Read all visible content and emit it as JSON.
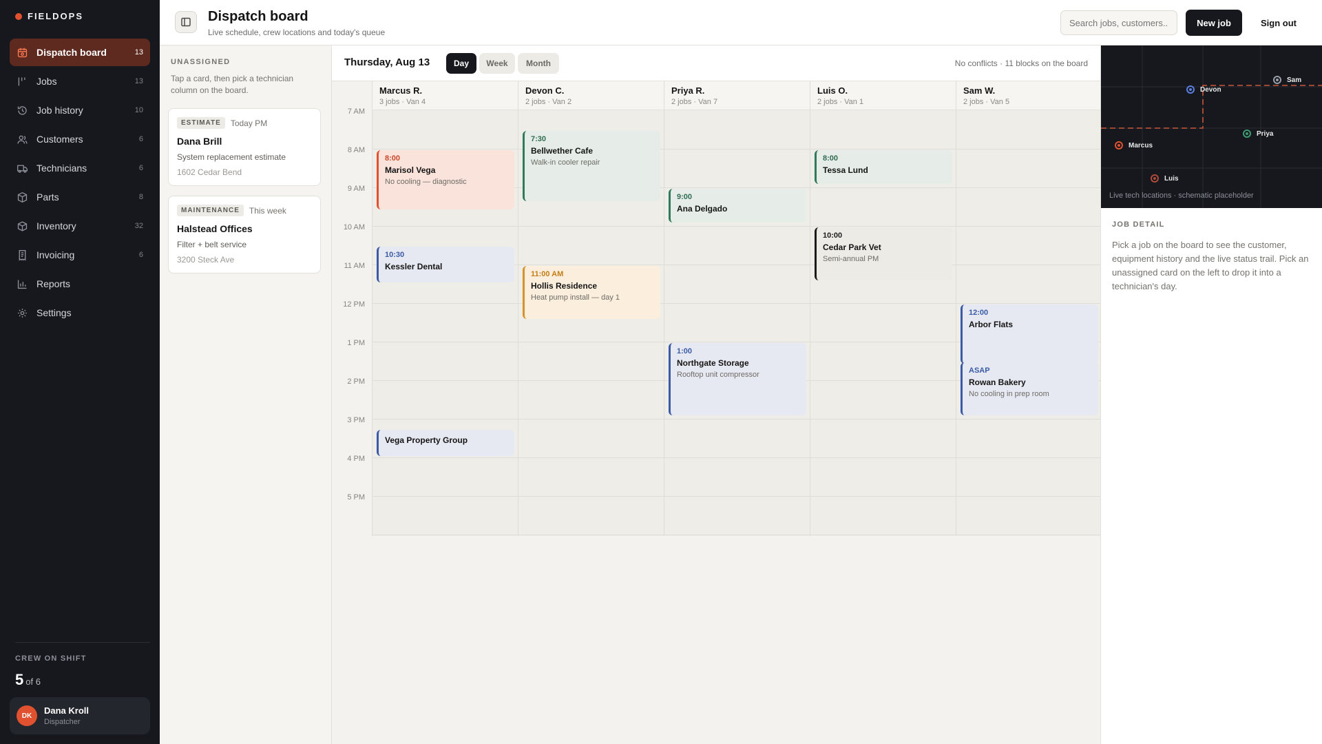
{
  "brand": {
    "name": "FIELDOPS",
    "accent": "#e0522f"
  },
  "sidebar": {
    "items": [
      {
        "label": "Dispatch board",
        "count": "13",
        "icon": "dispatch-icon",
        "active": true
      },
      {
        "label": "Jobs",
        "count": "13",
        "icon": "jobs-icon"
      },
      {
        "label": "Job history",
        "count": "10",
        "icon": "history-icon"
      },
      {
        "label": "Customers",
        "count": "6",
        "icon": "customers-icon"
      },
      {
        "label": "Technicians",
        "count": "6",
        "icon": "truck-icon"
      },
      {
        "label": "Parts",
        "count": "8",
        "icon": "box-icon"
      },
      {
        "label": "Inventory",
        "count": "32",
        "icon": "inventory-icon"
      },
      {
        "label": "Invoicing",
        "count": "6",
        "icon": "invoice-icon"
      },
      {
        "label": "Reports",
        "count": "",
        "icon": "chart-icon"
      },
      {
        "label": "Settings",
        "count": "",
        "icon": "gear-icon"
      }
    ],
    "crew": {
      "label": "CREW ON SHIFT",
      "count": "5",
      "of": "of 6"
    },
    "user": {
      "initials": "DK",
      "name": "Dana Kroll",
      "role": "Dispatcher"
    }
  },
  "header": {
    "title": "Dispatch board",
    "subtitle": "Live schedule, crew locations and today's queue",
    "search_placeholder": "Search jobs, customers...",
    "new_job": "New job",
    "sign_out": "Sign out"
  },
  "unassigned": {
    "title": "UNASSIGNED",
    "help": "Tap a card, then pick a technician column on the board.",
    "cards": [
      {
        "tag": "ESTIMATE",
        "when": "Today PM",
        "name": "Dana Brill",
        "desc": "System replacement estimate",
        "addr": "1602 Cedar Bend"
      },
      {
        "tag": "MAINTENANCE",
        "when": "This week",
        "name": "Halstead Offices",
        "desc": "Filter + belt service",
        "addr": "3200 Steck Ave"
      }
    ]
  },
  "board": {
    "date": "Thursday, Aug 13",
    "views": [
      "Day",
      "Week",
      "Month"
    ],
    "active_view": "Day",
    "status": "No conflicts · 11 blocks on the board",
    "hours": [
      "7 AM",
      "8 AM",
      "9 AM",
      "10 AM",
      "11 AM",
      "12 PM",
      "1 PM",
      "2 PM",
      "3 PM",
      "4 PM",
      "5 PM"
    ],
    "columns": [
      {
        "name": "Marcus R.",
        "sub": "3 jobs · Van 4",
        "jobs": [
          {
            "start": 8.0,
            "end": 9.6,
            "time": "8:00",
            "name": "Marisol Vega",
            "desc": "No cooling — diagnostic",
            "tone": "coral"
          },
          {
            "start": 10.5,
            "end": 11.5,
            "time": "10:30",
            "name": "Kessler Dental",
            "desc": "",
            "tone": "blue"
          },
          {
            "start": 15.25,
            "end": 16.0,
            "time": "",
            "name": "Vega Property Group",
            "desc": "",
            "tone": "blue"
          }
        ]
      },
      {
        "name": "Devon C.",
        "sub": "2 jobs · Van 2",
        "jobs": [
          {
            "start": 7.5,
            "end": 9.4,
            "time": "7:30",
            "name": "Bellwether Cafe",
            "desc": "Walk-in cooler repair",
            "tone": "green"
          },
          {
            "start": 11.0,
            "end": 12.45,
            "time": "11:00 AM",
            "name": "Hollis Residence",
            "desc": "Heat pump install — day 1",
            "tone": "amber"
          }
        ]
      },
      {
        "name": "Priya R.",
        "sub": "2 jobs · Van 7",
        "jobs": [
          {
            "start": 9.0,
            "end": 9.95,
            "time": "9:00",
            "name": "Ana Delgado",
            "desc": "",
            "tone": "green"
          },
          {
            "start": 13.0,
            "end": 14.95,
            "time": "1:00",
            "name": "Northgate Storage",
            "desc": "Rooftop unit compressor",
            "tone": "blue"
          }
        ]
      },
      {
        "name": "Luis O.",
        "sub": "2 jobs · Van 1",
        "jobs": [
          {
            "start": 8.0,
            "end": 8.95,
            "time": "8:00",
            "name": "Tessa Lund",
            "desc": "",
            "tone": "green"
          },
          {
            "start": 10.0,
            "end": 11.45,
            "time": "10:00",
            "name": "Cedar Park Vet",
            "desc": "Semi-annual PM",
            "tone": "gray"
          }
        ]
      },
      {
        "name": "Sam W.",
        "sub": "2 jobs · Van 5",
        "jobs": [
          {
            "start": 12.0,
            "end": 13.6,
            "time": "12:00",
            "name": "Arbor Flats",
            "desc": "",
            "tone": "blue"
          },
          {
            "start": 13.5,
            "end": 14.95,
            "time": "ASAP",
            "name": "Rowan Bakery",
            "desc": "No cooling in prep room",
            "tone": "blue"
          }
        ]
      }
    ]
  },
  "map": {
    "caption": "Live tech locations · schematic placeholder",
    "pins": [
      {
        "label": "Sam",
        "color": "#9aa0aa"
      },
      {
        "label": "Devon",
        "color": "#5b7fe0"
      },
      {
        "label": "Priya",
        "color": "#3f9a73"
      },
      {
        "label": "Marcus",
        "color": "#e0522f"
      },
      {
        "label": "Luis",
        "color": "#b04a3a"
      }
    ]
  },
  "job_detail": {
    "title": "JOB DETAIL",
    "body": "Pick a job on the board to see the customer, equipment history and the live status trail. Pick an unassigned card on the left to drop it into a technician's day."
  }
}
